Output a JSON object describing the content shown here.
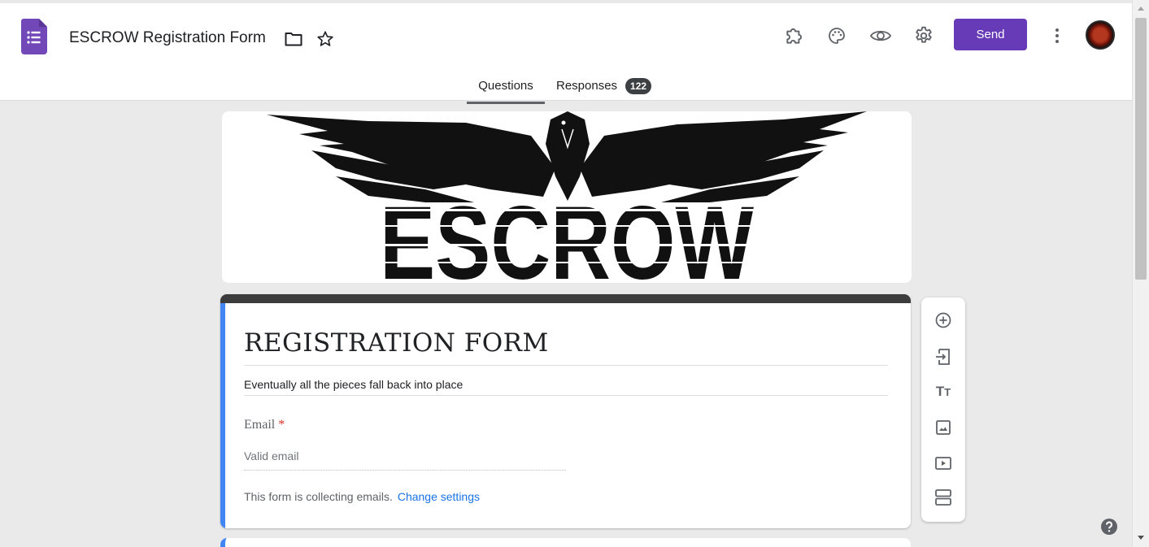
{
  "header": {
    "doc_title": "ESCROW Registration Form",
    "send_label": "Send",
    "icons": [
      "forms-app-icon",
      "folder-icon",
      "star-icon",
      "addon-icon",
      "palette-icon",
      "preview-icon",
      "settings-icon",
      "more-vert-icon",
      "avatar"
    ]
  },
  "tabs": {
    "questions": "Questions",
    "responses": "Responses",
    "responses_count": "122"
  },
  "banner": {
    "text": "ESCROW"
  },
  "form": {
    "title": "REGISTRATION FORM",
    "description": "Eventually all the pieces fall back into place",
    "email_label": "Email",
    "required_marker": "*",
    "email_placeholder": "Valid email",
    "collecting_note": "This form is collecting emails.",
    "change_settings": "Change settings"
  },
  "toolbar": {
    "tools": [
      "add-question",
      "import-questions",
      "add-title-and-description",
      "add-image",
      "add-video",
      "add-section"
    ],
    "title_glyph_big": "T",
    "title_glyph_small": "T"
  },
  "colors": {
    "accent": "#673ab7",
    "card_left": "#4285f4",
    "card_top": "#3c3c3c",
    "link": "#1a73e8",
    "required": "#d93025"
  }
}
